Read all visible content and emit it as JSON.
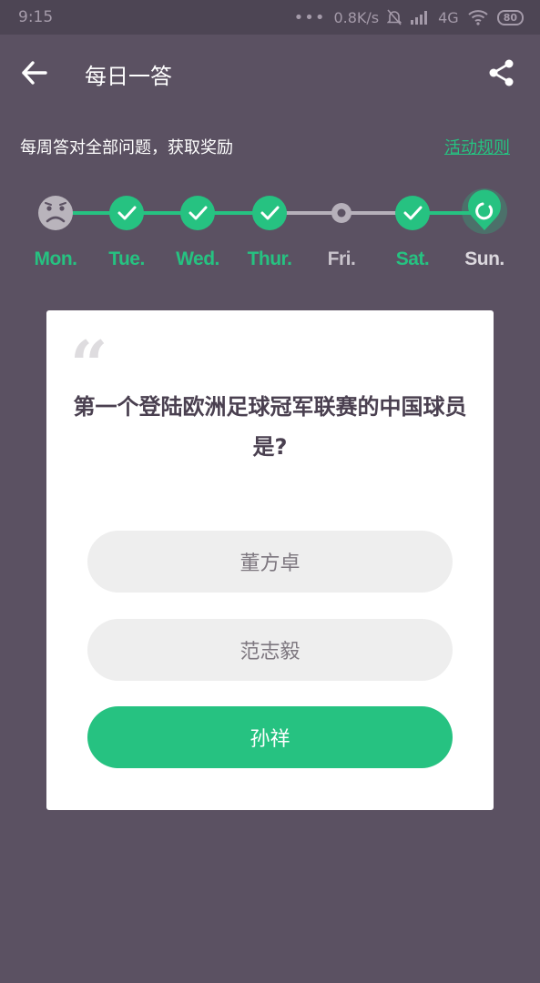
{
  "status_bar": {
    "time": "9:15",
    "dots": "•••",
    "speed": "0.8K/s",
    "network": "4G",
    "battery": "80"
  },
  "app_bar": {
    "title": "每日一答"
  },
  "subtitle": "每周答对全部问题，获取奖励",
  "rules_link": "活动规则",
  "week": {
    "days": [
      {
        "label": "Mon.",
        "state": "failed"
      },
      {
        "label": "Tue.",
        "state": "done"
      },
      {
        "label": "Wed.",
        "state": "done"
      },
      {
        "label": "Thur.",
        "state": "done"
      },
      {
        "label": "Fri.",
        "state": "pending"
      },
      {
        "label": "Sat.",
        "state": "done"
      },
      {
        "label": "Sun.",
        "state": "current"
      }
    ]
  },
  "card": {
    "quote_mark": "“",
    "question": "第一个登陆欧洲足球冠军联赛的中国球员是?",
    "options": [
      "董方卓",
      "范志毅",
      "孙祥"
    ]
  },
  "colors": {
    "background": "#5b5162",
    "accent": "#26c281",
    "inactive": "#b6b0ba",
    "card": "#ffffff",
    "option_bg": "#eeeeee"
  },
  "icons": {
    "back": "arrow-left-icon",
    "share": "share-icon",
    "failed": "sad-face-icon",
    "done": "check-icon",
    "pending": "dot-icon",
    "current": "location-pin-icon"
  }
}
